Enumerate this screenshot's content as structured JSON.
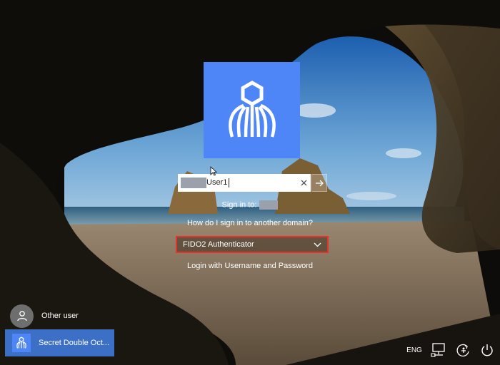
{
  "sign_in": {
    "username_value": "User1",
    "sign_in_to_label": "Sign in to:",
    "other_domain_link": "How do I sign in to another domain?",
    "authenticator_selected": "FIDO2 Authenticator",
    "login_with_password_link": "Login with Username and Password"
  },
  "users": [
    {
      "label": "Other user"
    },
    {
      "label": "Secret Double Oct..."
    }
  ],
  "tray": {
    "language": "ENG"
  },
  "icons": {
    "logo": "octopus-logo-icon",
    "clear": "close-icon",
    "submit": "arrow-right-icon",
    "dropdown": "chevron-down-icon",
    "other_user": "person-icon",
    "network": "network-icon",
    "ease_of_access": "ease-of-access-icon",
    "power": "power-icon"
  },
  "colors": {
    "accent": "#4f86f7",
    "selected_user_bg": "#3c6fc6",
    "highlight_border": "#e6332a"
  }
}
